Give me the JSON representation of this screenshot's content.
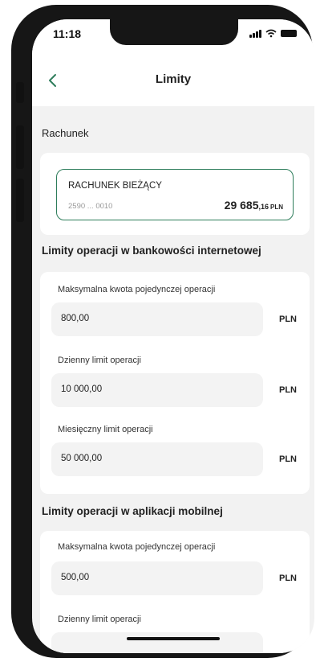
{
  "status_bar": {
    "time": "11:18"
  },
  "header": {
    "title": "Limity"
  },
  "account_section": {
    "label": "Rachunek",
    "account": {
      "name": "RACHUNEK BIEŻĄCY",
      "number": "2590 ... 0010",
      "balance_main": "29 685",
      "balance_decimal": ",16",
      "currency": "PLN"
    }
  },
  "internet_limits": {
    "heading": "Limity operacji w bankowości internetowej",
    "fields": [
      {
        "label": "Maksymalna kwota pojedynczej operacji",
        "value": "800,00",
        "currency": "PLN"
      },
      {
        "label": "Dzienny limit operacji",
        "value": "10 000,00",
        "currency": "PLN"
      },
      {
        "label": "Miesięczny limit operacji",
        "value": "50 000,00",
        "currency": "PLN"
      }
    ]
  },
  "mobile_limits": {
    "heading": "Limity operacji w aplikacji mobilnej",
    "fields": [
      {
        "label": "Maksymalna kwota pojedynczej operacji",
        "value": "500,00",
        "currency": "PLN"
      },
      {
        "label": "Dzienny limit operacji"
      }
    ]
  },
  "colors": {
    "accent_border": "#2e7d5b",
    "screen_bg": "#f2f2f2",
    "card_bg": "#ffffff",
    "field_bg": "#f3f3f3",
    "frame": "#161616"
  },
  "icons": {
    "back": "chevron-left-icon",
    "signal": "signal-icon",
    "wifi": "wifi-icon",
    "battery": "battery-icon"
  }
}
